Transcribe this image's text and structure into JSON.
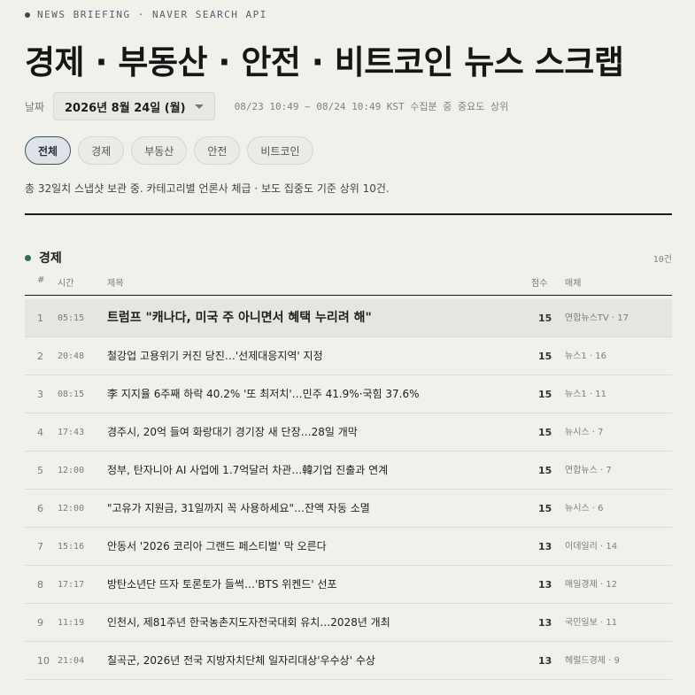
{
  "header": {
    "kicker": "NEWS BRIEFING · NAVER SEARCH API",
    "title": "경제 · 부동산 · 안전 · 비트코인 뉴스 스크랩"
  },
  "date_picker": {
    "label": "날짜",
    "selected": "2026년 8월 24일 (월)",
    "meta": "08/23 10:49 ~ 08/24 10:49 KST 수집분 중 중요도 상위"
  },
  "tabs": [
    {
      "label": "전체",
      "active": true
    },
    {
      "label": "경제",
      "active": false
    },
    {
      "label": "부동산",
      "active": false
    },
    {
      "label": "안전",
      "active": false
    },
    {
      "label": "비트코인",
      "active": false
    }
  ],
  "summary": "총 32일치 스냅샷 보관 중. 카테고리별 언론사 체급 · 보도 집중도 기준 상위 10건.",
  "section": {
    "title": "경제",
    "count": "10건",
    "columns": {
      "num": "#",
      "time": "시간",
      "title": "제목",
      "score": "점수",
      "media": "매체"
    },
    "rows": [
      {
        "num": "1",
        "time": "05:15",
        "title": "트럼프 \"캐나다, 미국 주 아니면서 혜택 누리려 해\"",
        "score": "15",
        "media": "연합뉴스TV · 17"
      },
      {
        "num": "2",
        "time": "20:48",
        "title": "철강업 고용위기 커진 당진…'선제대응지역' 지정",
        "score": "15",
        "media": "뉴스1 · 16"
      },
      {
        "num": "3",
        "time": "08:15",
        "title": "李 지지율 6주째 하락 40.2% '또 최저치'…민주 41.9%·국힘 37.6%",
        "score": "15",
        "media": "뉴스1 · 11"
      },
      {
        "num": "4",
        "time": "17:43",
        "title": "경주시, 20억 들여 화랑대기 경기장 새 단장…28일 개막",
        "score": "15",
        "media": "뉴시스 · 7"
      },
      {
        "num": "5",
        "time": "12:00",
        "title": "정부, 탄자니아 AI 사업에 1.7억달러 차관…韓기업 진출과 연계",
        "score": "15",
        "media": "연합뉴스 · 7"
      },
      {
        "num": "6",
        "time": "12:00",
        "title": "\"고유가 지원금, 31일까지 꼭 사용하세요\"…잔액 자동 소멸",
        "score": "15",
        "media": "뉴시스 · 6"
      },
      {
        "num": "7",
        "time": "15:16",
        "title": "안동서 '2026 코리아 그랜드 페스티벌' 막 오른다",
        "score": "13",
        "media": "이데일리 · 14"
      },
      {
        "num": "8",
        "time": "17:17",
        "title": "방탄소년단 뜨자 토론토가 들썩…'BTS 위켄드' 선포",
        "score": "13",
        "media": "매일경제 · 12"
      },
      {
        "num": "9",
        "time": "11:19",
        "title": "인천시, 제81주년 한국농촌지도자전국대회 유치…2028년 개최",
        "score": "13",
        "media": "국민일보 · 11"
      },
      {
        "num": "10",
        "time": "21:04",
        "title": "칠곡군, 2026년 전국 지방자치단체 일자리대상'우수상' 수상",
        "score": "13",
        "media": "헤럴드경제 · 9"
      }
    ]
  }
}
